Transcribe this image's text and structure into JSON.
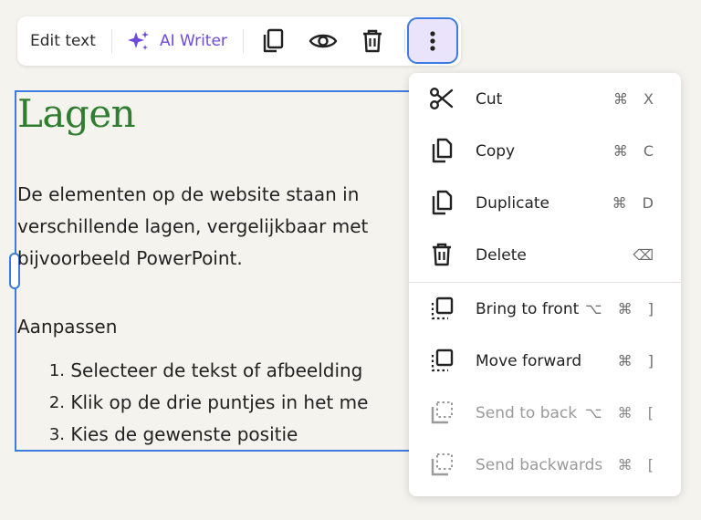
{
  "toolbar": {
    "edit_text": "Edit text",
    "ai_writer": "AI Writer",
    "icons": [
      "copy-icon",
      "eye-icon",
      "trash-icon",
      "more-vertical-icon"
    ],
    "colors": {
      "ai_accent": "#6e4bd8",
      "selection": "#3d7be0",
      "more_bg": "#e9e3fb"
    }
  },
  "content": {
    "title": "Lagen",
    "paragraph_lines": [
      "De elementen op de website staan in",
      "verschillende lagen, vergelijkbaar met",
      "bijvoorbeeld PowerPoint."
    ],
    "subheading": "Aanpassen",
    "list": [
      {
        "num": "1.",
        "text": "Selecteer de tekst of afbeelding"
      },
      {
        "num": "2.",
        "text": "Klik op de drie puntjes in het me"
      },
      {
        "num": "3.",
        "text": "Kies de gewenste positie"
      }
    ],
    "title_color": "#2f7d2f"
  },
  "menu": {
    "items": [
      {
        "label": "Cut",
        "shortcut": "⌘ X",
        "icon": "scissors-icon"
      },
      {
        "label": "Copy",
        "shortcut": "⌘ C",
        "icon": "copy-icon"
      },
      {
        "label": "Duplicate",
        "shortcut": "⌘ D",
        "icon": "duplicate-icon"
      },
      {
        "label": "Delete",
        "shortcut": "⌫",
        "icon": "trash-icon"
      },
      {
        "label": "Bring to front",
        "shortcut": "⌥ ⌘ ]",
        "icon": "bring-to-front-icon"
      },
      {
        "label": "Move forward",
        "shortcut": "⌘ ]",
        "icon": "move-forward-icon"
      },
      {
        "label": "Send to back",
        "shortcut": "⌥ ⌘ [",
        "icon": "send-to-back-icon",
        "disabled": true
      },
      {
        "label": "Send backwards",
        "shortcut": "⌘ [",
        "icon": "send-backwards-icon",
        "disabled": true
      }
    ]
  }
}
